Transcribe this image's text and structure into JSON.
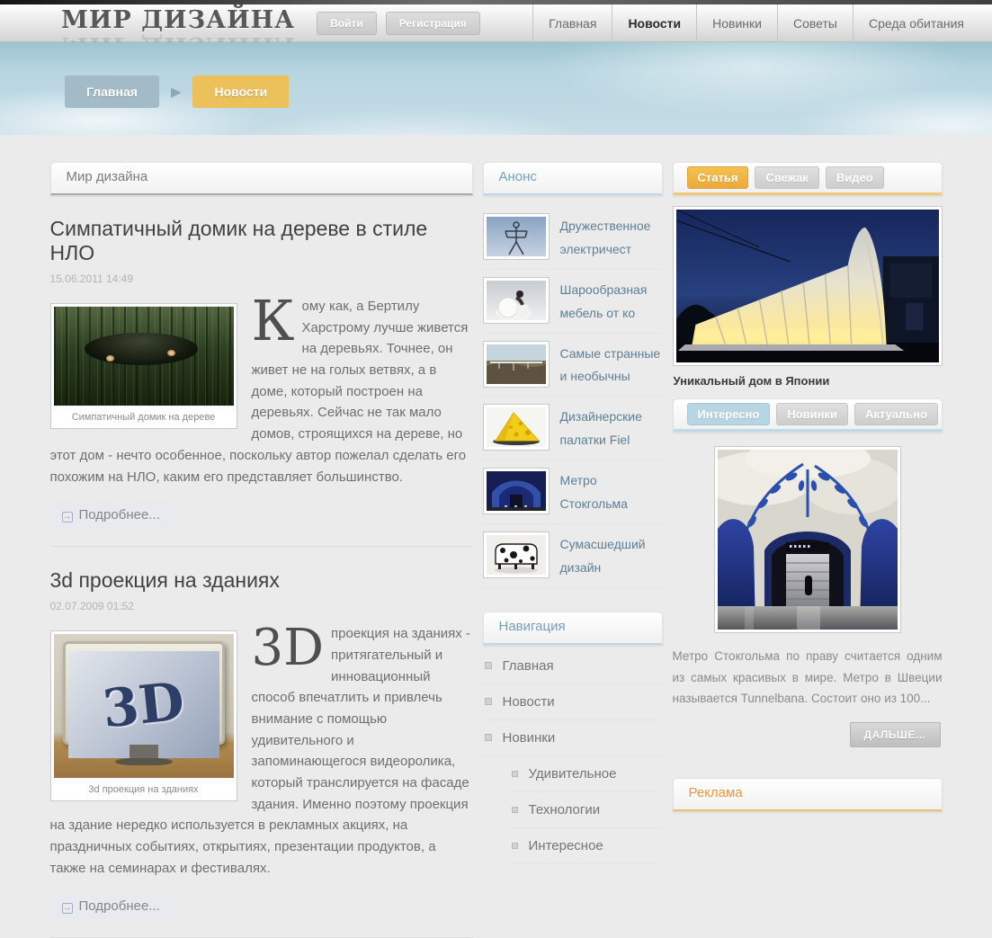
{
  "header": {
    "logo": "МИР ДИЗАЙНА",
    "login": "Войти",
    "register": "Регистрация",
    "nav": [
      {
        "label": "Главная"
      },
      {
        "label": "Новости"
      },
      {
        "label": "Новинки"
      },
      {
        "label": "Советы"
      },
      {
        "label": "Среда обитания"
      }
    ]
  },
  "breadcrumb": {
    "home": "Главная",
    "current": "Новости"
  },
  "left": {
    "section_title": "Мир дизайна",
    "article1": {
      "title": "Симпатичный домик на дереве в стиле НЛО",
      "date": "15.06.2011 14:49",
      "caption": "Симпатичный домик на дереве",
      "dropcap": "К",
      "text": "ому как, а Бертилу Харстрому лучше живется на деревьях. Точнее, он живет не на голых ветвях, а в доме, который построен на деревьях. Сейчас не так мало домов, строящихся на дереве, но этот дом - нечто особенное, поскольку автор пожелал сделать его похожим на НЛО, каким его представляет большинство.",
      "more": "Подробнее..."
    },
    "article2": {
      "title": "3d проекция на зданиях",
      "date": "02.07.2009 01:52",
      "caption": "3d проекция на зданиях",
      "dropcap": "3D",
      "text": "проекция на зданиях - притягательный и инновационный способ впечатлить и привлечь внимание с помощью удивительного и запоминающегося видеоролика, который транслируется на фасаде здания. Именно поэтому проекция на здание нередко используется в рекламных акциях, на праздничных событиях, открытиях, презентации продуктов, а также на семинарах и фестивалях.",
      "more": "Подробнее..."
    }
  },
  "announce": {
    "title": "Анонс",
    "items": [
      {
        "title": "Дружественное электричест",
        "icon": "power-pylon-thumbnail"
      },
      {
        "title": "Шарообразная мебель от ко",
        "icon": "ball-furniture-thumbnail"
      },
      {
        "title": "Самые странные и необычны",
        "icon": "bridge-landscape-thumbnail"
      },
      {
        "title": "Дизайнерские палатки Fiel",
        "icon": "cheese-tent-thumbnail"
      },
      {
        "title": "Метро Стокгольма",
        "icon": "metro-station-thumbnail"
      },
      {
        "title": "Сумасшедший дизайн",
        "icon": "cow-sofa-thumbnail"
      }
    ]
  },
  "navigation": {
    "title": "Навигация",
    "items": [
      {
        "label": "Главная",
        "level": 1
      },
      {
        "label": "Новости",
        "level": 1
      },
      {
        "label": "Новинки",
        "level": 1
      },
      {
        "label": "Удивительное",
        "level": 2
      },
      {
        "label": "Технологии",
        "level": 2
      },
      {
        "label": "Интересное",
        "level": 2
      }
    ]
  },
  "right": {
    "tabs1": [
      {
        "label": "Статья",
        "active": true
      },
      {
        "label": "Свежак",
        "active": false
      },
      {
        "label": "Видео",
        "active": false
      }
    ],
    "featured_caption": "Уникальный дом в Японии",
    "tabs2": [
      {
        "label": "Интересно",
        "active": true
      },
      {
        "label": "Новинки",
        "active": false
      },
      {
        "label": "Актуально",
        "active": false
      }
    ],
    "teaser_text": "Метро Стокгольма по праву считается одним из самых красивых в мире. Метро в Швеции называется Tunnelbana. Состоит оно из 100...",
    "next_button": "ДАЛЬШЕ...",
    "ads_title": "Реклама"
  },
  "colors": {
    "accent_orange": "#efba45",
    "accent_blue": "#b7d5e3",
    "breadcrumb_home": "#a3bbc6",
    "breadcrumb_current": "#ecc05a",
    "ads_text": "#e9993f",
    "announce_link": "#5d7f95"
  }
}
